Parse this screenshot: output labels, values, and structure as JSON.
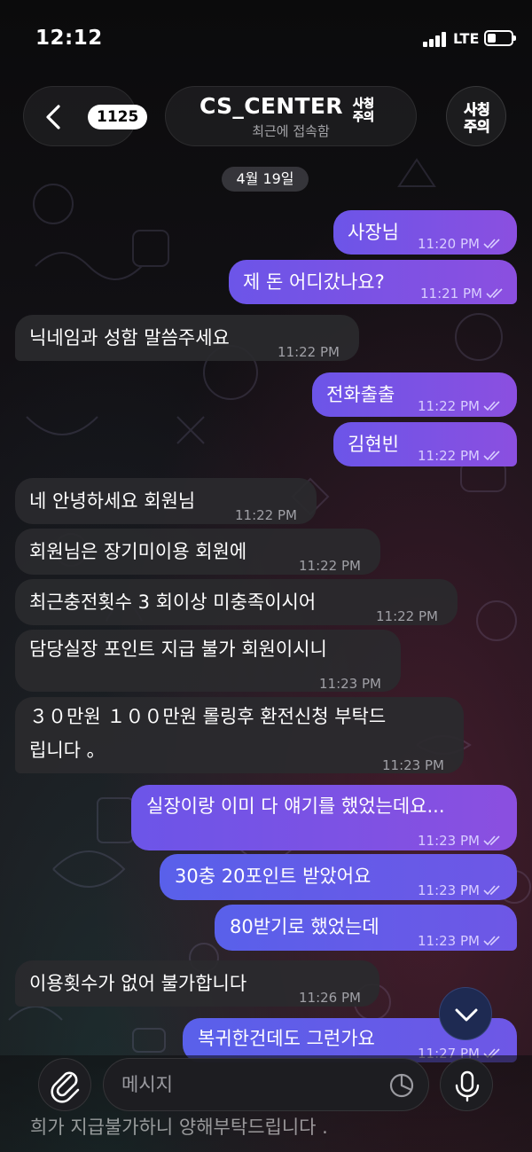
{
  "status_bar": {
    "time": "12:12",
    "network": "LTE",
    "battery_level": 0.35
  },
  "header": {
    "back_count": "1125",
    "title": "CS_CENTER",
    "subtitle": "최근에 접속함",
    "badge_text_line1": "사칭",
    "badge_text_line2": "주의"
  },
  "date_separator": "4월 19일",
  "messages": [
    {
      "dir": "out",
      "text": "사장님",
      "time": "11:20 PM"
    },
    {
      "dir": "out",
      "text": "제 돈 어디갔나요?",
      "time": "11:21 PM"
    },
    {
      "dir": "in",
      "text": "닉네임과 성함 말씀주세요",
      "time": "11:22 PM"
    },
    {
      "dir": "out",
      "text": "전화출출",
      "time": "11:22 PM"
    },
    {
      "dir": "out",
      "text": "김현빈",
      "time": "11:22 PM"
    },
    {
      "dir": "in",
      "text": "네 안녕하세요 회원님",
      "time": "11:22 PM"
    },
    {
      "dir": "in",
      "text": "회원님은 장기미이용 회원에",
      "time": "11:22 PM"
    },
    {
      "dir": "in",
      "text": "최근충전횟수 3 회이상 미충족이시어",
      "time": "11:22 PM"
    },
    {
      "dir": "in",
      "text": "담당실장 포인트 지급 불가 회원이시니",
      "time": "11:23 PM"
    },
    {
      "dir": "in",
      "text_line1": "３０만원 １００만원 롤링후 환전신청 부탁드",
      "text_line2": "립니다 。",
      "time": "11:23 PM"
    },
    {
      "dir": "out",
      "text": "실장이랑 이미 다 얘기를 했었는데요...",
      "time": "11:23 PM"
    },
    {
      "dir": "out",
      "text": "30충 20포인트 받았어요",
      "time": "11:23 PM"
    },
    {
      "dir": "out",
      "text": "80받기로 했었는데",
      "time": "11:23 PM"
    },
    {
      "dir": "in",
      "text": "이용횟수가 없어 불가합니다",
      "time": "11:26 PM"
    },
    {
      "dir": "out",
      "text": "복귀한건데도 그런가요",
      "time": "11:27 PM"
    }
  ],
  "partial_message": "희가 지급불가하니 양해부탁드립니다 .",
  "composer": {
    "placeholder": "메시지"
  },
  "colors": {
    "outgoing_start": "#6c55e8",
    "outgoing_end": "#8b4fe0",
    "incoming": "#2a2a2e",
    "badge_red": "#e0242a"
  }
}
